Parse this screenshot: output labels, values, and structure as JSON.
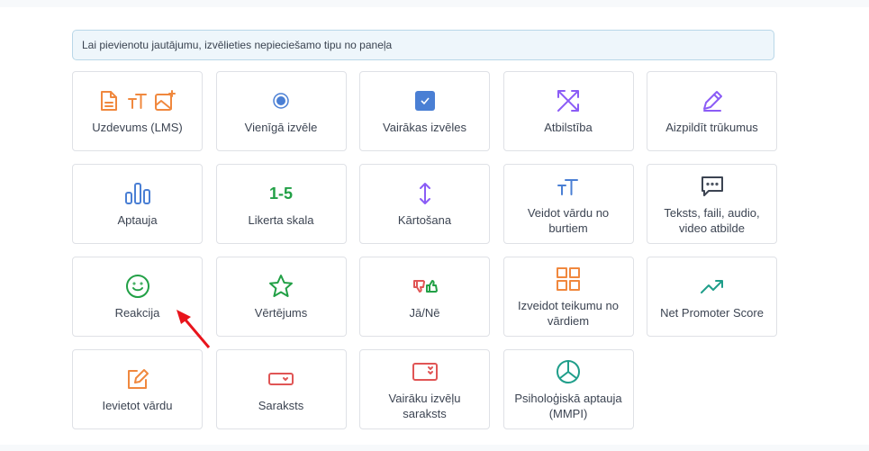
{
  "notice": "Lai pievienotu jautājumu, izvēlieties nepieciešamo tipu no paneļa",
  "cards": [
    {
      "label": "Uzdevums (LMS)",
      "icon": "document-text-image-icon"
    },
    {
      "label": "Vienīgā izvēle",
      "icon": "radio-icon"
    },
    {
      "label": "Vairākas izvēles",
      "icon": "checkbox-icon"
    },
    {
      "label": "Atbilstība",
      "icon": "arrows-diagonal-icon"
    },
    {
      "label": "Aizpildīt trūkumus",
      "icon": "pencil-icon"
    },
    {
      "label": "Aptauja",
      "icon": "bar-chart-icon"
    },
    {
      "label": "Likerta skala",
      "icon": "likert-icon",
      "icon_text": "1-5"
    },
    {
      "label": "Kārtošana",
      "icon": "sort-arrows-icon"
    },
    {
      "label": "Veidot vārdu no burtiem",
      "icon": "text-size-icon"
    },
    {
      "label": "Teksts, faili, audio, video atbilde",
      "icon": "message-icon"
    },
    {
      "label": "Reakcija",
      "icon": "smile-icon"
    },
    {
      "label": "Vērtējums",
      "icon": "star-icon"
    },
    {
      "label": "Jā/Nē",
      "icon": "thumbs-icon"
    },
    {
      "label": "Izveidot teikumu no vārdiem",
      "icon": "grid-icon"
    },
    {
      "label": "Net Promoter Score",
      "icon": "trending-up-icon"
    },
    {
      "label": "Ievietot vārdu",
      "icon": "edit-icon"
    },
    {
      "label": "Saraksts",
      "icon": "dropdown-icon"
    },
    {
      "label": "Vairāku izvēļu saraksts",
      "icon": "multi-dropdown-icon"
    },
    {
      "label": "Psiholoģiskā aptauja (MMPI)",
      "icon": "pie-chart-icon"
    }
  ],
  "colors": {
    "orange": "#f0883e",
    "blue": "#4a7fd4",
    "purple": "#8b5cf6",
    "green": "#22a046",
    "red": "#e05555",
    "teal": "#1f9e8a",
    "arrow": "#e8141c"
  }
}
